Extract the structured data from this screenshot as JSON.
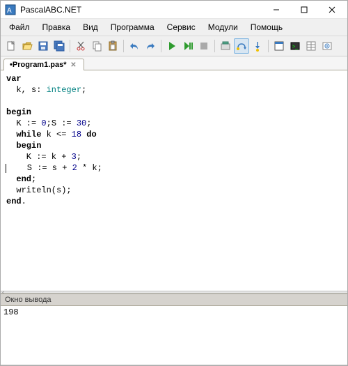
{
  "window": {
    "title": "PascalABC.NET"
  },
  "menu": {
    "file": "Файл",
    "edit": "Правка",
    "view": "Вид",
    "program": "Программа",
    "service": "Сервис",
    "modules": "Модули",
    "help": "Помощь"
  },
  "tab": {
    "name": "•Program1.pas*"
  },
  "code": {
    "l1a": "var",
    "l2a": "  k, s: ",
    "l2b": "integer",
    "l2c": ";",
    "l3": "",
    "l4a": "begin",
    "l5a": "  K := ",
    "l5b": "0",
    "l5c": ";S := ",
    "l5d": "30",
    "l5e": ";",
    "l6a": "  ",
    "l6b": "while",
    "l6c": " k <= ",
    "l6d": "18",
    "l6e": " ",
    "l6f": "do",
    "l7a": "  ",
    "l7b": "begin",
    "l8a": "    K := k + ",
    "l8b": "3",
    "l8c": ";",
    "l9a": "    S := s + ",
    "l9b": "2",
    "l9c": " * k;",
    "l10a": "  ",
    "l10b": "end",
    "l10c": ";",
    "l11a": "  writeln(s);",
    "l12a": "end",
    "l12b": "."
  },
  "outputPanel": {
    "title": "Окно вывода",
    "text": "198"
  }
}
